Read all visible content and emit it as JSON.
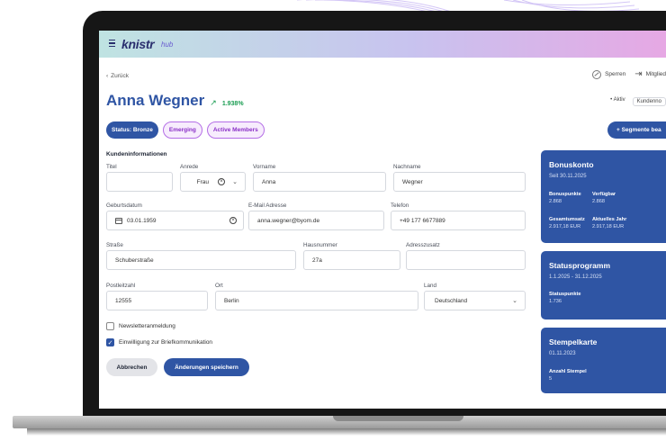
{
  "app": {
    "brand": "knistr",
    "brand_sub": "hub"
  },
  "nav": {
    "back_label": "Zurück"
  },
  "top_actions": {
    "block_label": "Sperren",
    "member_label": "Mitglied"
  },
  "customer": {
    "name": "Anna Wegner",
    "trend_value": "1.938%",
    "meta_status": "• Aktiv",
    "meta_type": "Kundenno"
  },
  "tags": [
    "Status: Bronze",
    "Emerging",
    "Active Members"
  ],
  "segments_button": "+ Segmente bea",
  "form": {
    "section_title": "Kundeninformationen",
    "labels": {
      "titel": "Titel",
      "anrede": "Anrede",
      "vorname": "Vorname",
      "nachname": "Nachname",
      "geburtsdatum": "Geburtsdatum",
      "email": "E-Mail Adresse",
      "telefon": "Telefon",
      "strasse": "Straße",
      "hausnummer": "Hausnummer",
      "adresszusatz": "Adresszusatz",
      "plz": "Postleitzahl",
      "ort": "Ort",
      "land": "Land"
    },
    "values": {
      "titel": "",
      "anrede": "Frau",
      "vorname": "Anna",
      "nachname": "Wegner",
      "geburtsdatum": "03.01.1959",
      "email": "anna.wegner@byom.de",
      "telefon": "+49 177 6677889",
      "strasse": "Schuberstraße",
      "hausnummer": "27a",
      "adresszusatz": "",
      "plz": "12555",
      "ort": "Berlin",
      "land": "Deutschland"
    },
    "newsletter_label": "Newsletteranmeldung",
    "newsletter_checked": false,
    "letter_label": "Einwilligung zur Briefkommunikation",
    "letter_checked": true,
    "cancel_label": "Abbrechen",
    "save_label": "Änderungen speichern"
  },
  "cards": {
    "bonus": {
      "title": "Bonuskonto",
      "since": "Seit 30.11.2025",
      "points_label": "Bonuspunkte",
      "points_value": "2.868",
      "available_label": "Verfügbar",
      "available_value": "2.868",
      "total_label": "Gesamtumsatz",
      "total_value": "2.917,18 EUR",
      "year_label": "Aktuelles Jahr",
      "year_value": "2.917,18 EUR"
    },
    "status": {
      "title": "Statusprogramm",
      "period": "1.1.2025 - 31.12.2025",
      "points_label": "Statuspunkte",
      "points_value": "1.736"
    },
    "stamp": {
      "title": "Stempelkarte",
      "date": "01.11.2023",
      "count_label": "Anzahl Stempel",
      "count_value": "5"
    }
  },
  "colors": {
    "primary": "#2f55a4",
    "trend_green": "#1a9d52",
    "tag_purple": "#8a2fc7"
  }
}
